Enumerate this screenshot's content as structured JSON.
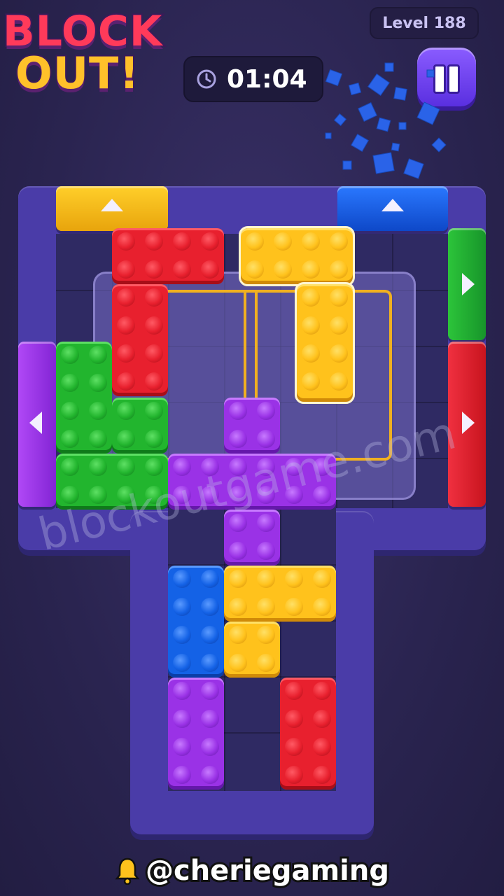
{
  "header": {
    "logo_line1": "BLOCK",
    "logo_line2": "OUT!",
    "level_label": "Level 188",
    "timer": "01:04"
  },
  "watermark": "blockoutgame.com",
  "footer": {
    "handle": "@cheriegaming"
  },
  "colors": {
    "red": "#e8202e",
    "yellow": "#ffc21c",
    "green": "#22b52e",
    "purple": "#9a32e6",
    "blue": "#1462e6",
    "frame": "#4a3ca8",
    "track": "#f0b020"
  },
  "doors": [
    {
      "name": "yellow-door-top",
      "color": "yellow",
      "direction": "up"
    },
    {
      "name": "blue-door-top",
      "color": "blue",
      "direction": "up"
    },
    {
      "name": "green-door-right",
      "color": "green",
      "direction": "right"
    },
    {
      "name": "red-door-right",
      "color": "red",
      "direction": "right"
    },
    {
      "name": "purple-door-left",
      "color": "purple",
      "direction": "left"
    }
  ],
  "blocks": [
    {
      "name": "red-block-top",
      "color": "red",
      "selected": false
    },
    {
      "name": "yellow-block-top",
      "color": "yellow",
      "selected": true
    },
    {
      "name": "green-block",
      "color": "green",
      "selected": false
    },
    {
      "name": "purple-cross-block",
      "color": "purple",
      "selected": false
    },
    {
      "name": "blue-block",
      "color": "blue",
      "selected": false
    },
    {
      "name": "yellow-block-bottom",
      "color": "yellow",
      "selected": false
    },
    {
      "name": "purple-block-bottom",
      "color": "purple",
      "selected": false
    },
    {
      "name": "red-block-bottom",
      "color": "red",
      "selected": false
    }
  ]
}
